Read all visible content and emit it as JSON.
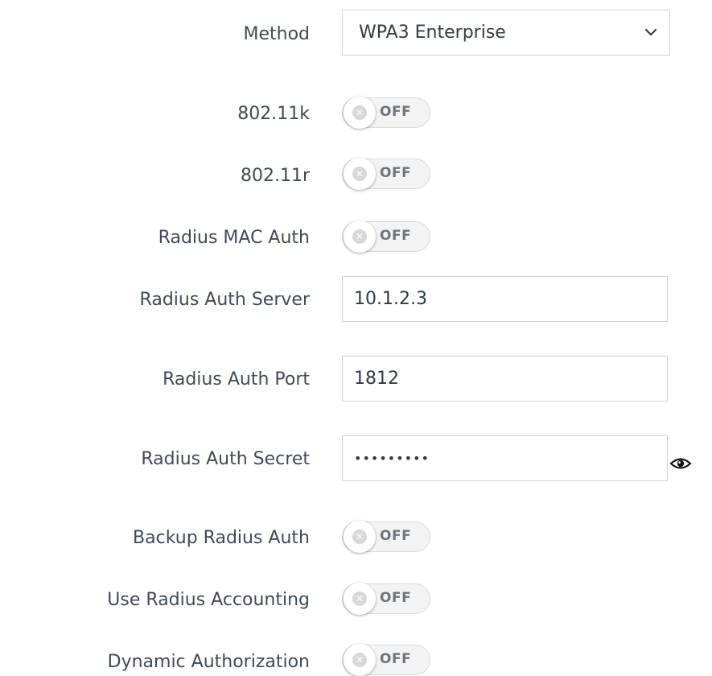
{
  "rows": {
    "method": {
      "label": "Method",
      "value": "WPA3 Enterprise",
      "icon": "chevron-down-icon"
    },
    "k80211": {
      "label": "802.11k",
      "state": "OFF"
    },
    "r80211": {
      "label": "802.11r",
      "state": "OFF"
    },
    "radius_mac_auth": {
      "label": "Radius MAC Auth",
      "state": "OFF"
    },
    "radius_auth_server": {
      "label": "Radius Auth Server",
      "value": "10.1.2.3"
    },
    "radius_auth_port": {
      "label": "Radius Auth Port",
      "value": "1812"
    },
    "radius_auth_secret": {
      "label": "Radius Auth Secret",
      "value": "•••••••••",
      "icon": "eye-icon"
    },
    "backup_radius_auth": {
      "label": "Backup Radius Auth",
      "state": "OFF"
    },
    "use_radius_accounting": {
      "label": "Use Radius Accounting",
      "state": "OFF"
    },
    "dynamic_authorization": {
      "label": "Dynamic Authorization",
      "state": "OFF"
    }
  },
  "colors": {
    "label_text": "#3f4b58",
    "field_border": "#cfd4d9",
    "toggle_track": "#f3f3f3",
    "toggle_text": "#6c757d"
  }
}
